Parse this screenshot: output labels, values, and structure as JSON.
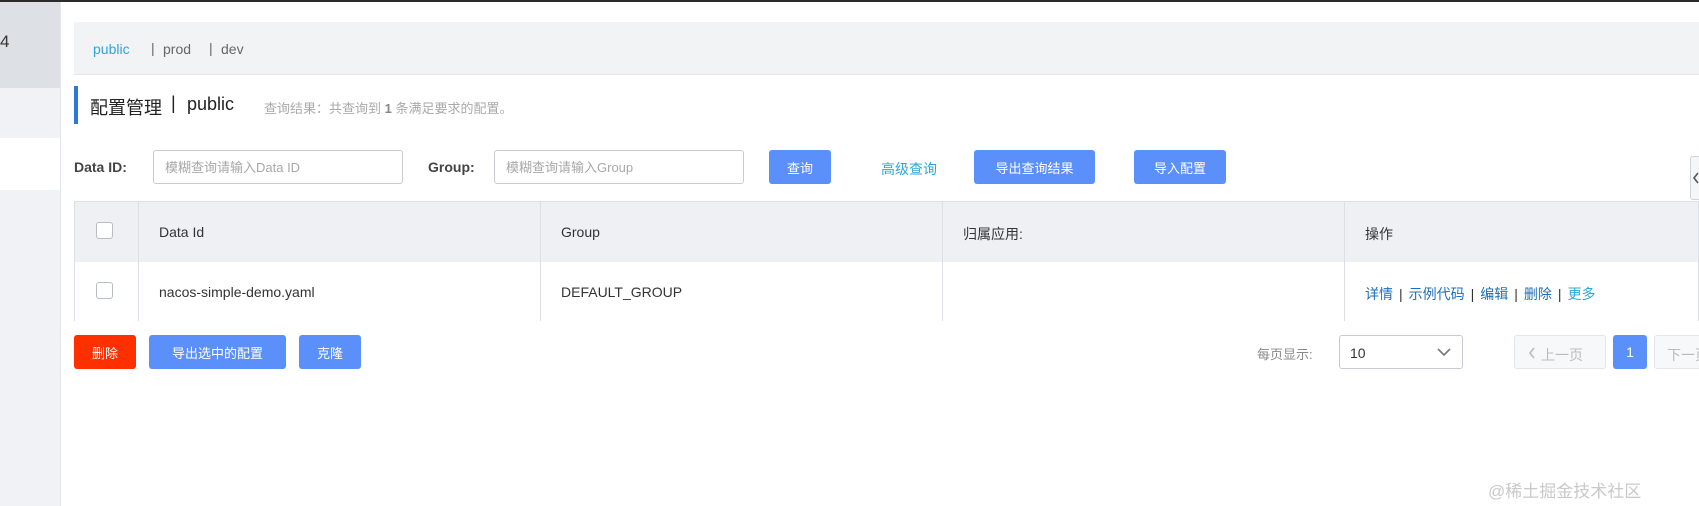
{
  "sidebar": {
    "number": "4"
  },
  "namespaces": {
    "items": [
      "public",
      "prod",
      "dev"
    ],
    "separator": "|",
    "active": "public"
  },
  "header": {
    "title": "配置管理",
    "separator": "|",
    "namespace": "public",
    "result_prefix": "查询结果：共查询到",
    "result_count": "1",
    "result_suffix": "条满足要求的配置。"
  },
  "search": {
    "data_id_label": "Data ID:",
    "data_id_placeholder": "模糊查询请输入Data ID",
    "data_id_value": "",
    "group_label": "Group:",
    "group_placeholder": "模糊查询请输入Group",
    "group_value": "",
    "query_button": "查询",
    "advanced_link": "高级查询",
    "export_button": "导出查询结果",
    "import_button": "导入配置"
  },
  "table": {
    "columns": [
      "Data Id",
      "Group",
      "归属应用:",
      "操作"
    ],
    "rows": [
      {
        "data_id": "nacos-simple-demo.yaml",
        "group": "DEFAULT_GROUP",
        "app": "",
        "actions": [
          "详情",
          "示例代码",
          "编辑",
          "删除",
          "更多"
        ]
      }
    ],
    "action_separator": "|"
  },
  "bulk": {
    "delete_button": "删除",
    "export_selected_button": "导出选中的配置",
    "clone_button": "克隆"
  },
  "pagination": {
    "page_size_label": "每页显示:",
    "page_size": "10",
    "prev_label": "上一页",
    "current_page": "1",
    "next_label": "下一页"
  },
  "colors": {
    "primary": "#5b8ff9",
    "link": "#2ba7d6",
    "danger": "#ff3000",
    "title_accent": "#2b78d6"
  },
  "watermark": "@稀土掘金技术社区"
}
